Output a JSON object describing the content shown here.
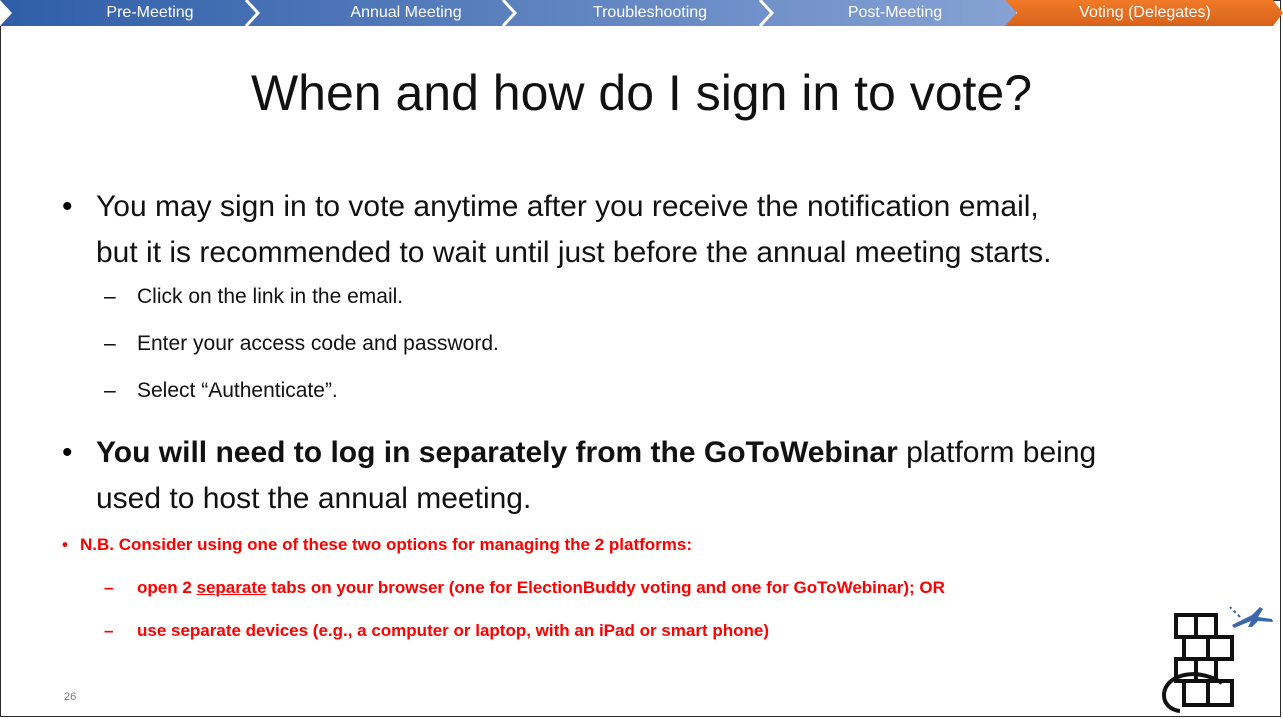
{
  "nav": {
    "tabs": [
      {
        "label": "Pre-Meeting",
        "active": false
      },
      {
        "label": "Annual Meeting",
        "active": false
      },
      {
        "label": "Troubleshooting",
        "active": false
      },
      {
        "label": "Post-Meeting",
        "active": false
      },
      {
        "label": "Voting (Delegates)",
        "active": true
      }
    ],
    "colors": {
      "dark_blue": "#3b67ad",
      "light_blue": "#7796cc",
      "active_orange": "#e66f1f"
    }
  },
  "slide": {
    "title": "When and how do I sign in to vote?",
    "bullets": {
      "b1_line1": "You may sign in to vote anytime after you receive the notification email,",
      "b1_line2": "but it is recommended to wait until just before the annual meeting starts.",
      "sub1": "Click on the link in the email.",
      "sub2": "Enter your access code and password.",
      "sub3": "Select “Authenticate”.",
      "b2_bold": "You will need to log in separately from the GoToWebinar",
      "b2_rest": " platform being",
      "b2_line2": "used to host the annual meeting.",
      "nb": "N.B. Consider using one of these two options for managing the 2 platforms:",
      "nb_sub1_a": "open 2 ",
      "nb_sub1_u": "separate",
      "nb_sub1_b": " tabs on your browser (one for ElectionBuddy voting and one for GoToWebinar); OR",
      "nb_sub2": "use separate devices (e.g., a computer or laptop, with an iPad or smart phone)"
    },
    "page_number": "26",
    "accent_red": "#ff0000"
  }
}
